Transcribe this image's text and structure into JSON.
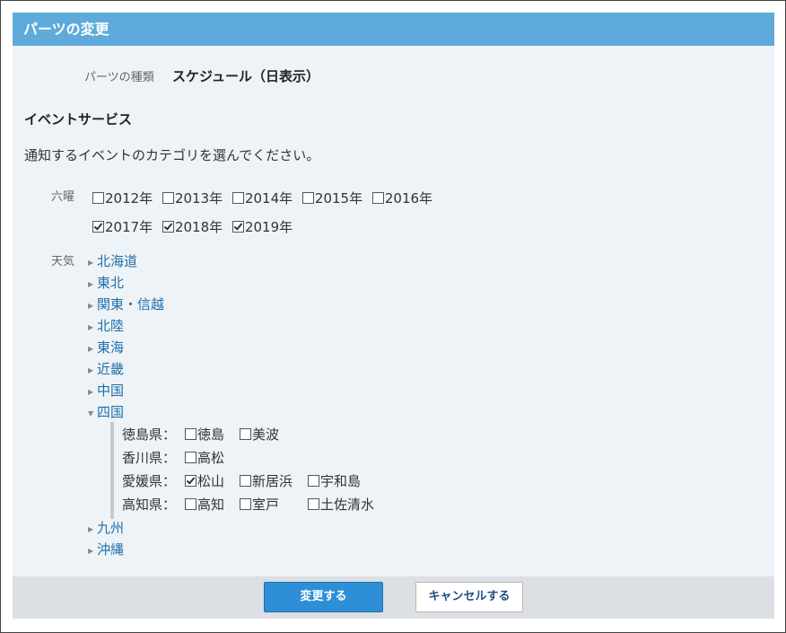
{
  "dialog": {
    "title": "パーツの変更",
    "type_label": "パーツの種類",
    "type_value": "スケジュール（日表示）",
    "section_title": "イベントサービス",
    "description": "通知するイベントのカテゴリを選んでください。"
  },
  "rokuyo": {
    "label": "六曜",
    "row1": [
      {
        "label": "2012年",
        "checked": false
      },
      {
        "label": "2013年",
        "checked": false
      },
      {
        "label": "2014年",
        "checked": false
      },
      {
        "label": "2015年",
        "checked": false
      },
      {
        "label": "2016年",
        "checked": false
      }
    ],
    "row2": [
      {
        "label": "2017年",
        "checked": true
      },
      {
        "label": "2018年",
        "checked": true
      },
      {
        "label": "2019年",
        "checked": true
      }
    ]
  },
  "weather": {
    "label": "天気",
    "regions": [
      {
        "label": "北海道",
        "arrow": "▶"
      },
      {
        "label": "東北",
        "arrow": "▶"
      },
      {
        "label": "関東・信越",
        "arrow": "▶"
      },
      {
        "label": "北陸",
        "arrow": "▶"
      },
      {
        "label": "東海",
        "arrow": "▶"
      },
      {
        "label": "近畿",
        "arrow": "▶"
      },
      {
        "label": "中国",
        "arrow": "▶"
      },
      {
        "label": "四国",
        "arrow": "▼"
      }
    ],
    "regions_after": [
      {
        "label": "九州",
        "arrow": "▶"
      },
      {
        "label": "沖縄",
        "arrow": "▶"
      }
    ],
    "shikoku": [
      {
        "pref": "徳島県：",
        "options": [
          {
            "label": "徳島",
            "checked": false
          },
          {
            "label": "美波",
            "checked": false
          }
        ]
      },
      {
        "pref": "香川県：",
        "options": [
          {
            "label": "高松",
            "checked": false
          }
        ]
      },
      {
        "pref": "愛媛県：",
        "options": [
          {
            "label": "松山",
            "checked": true
          },
          {
            "label": "新居浜",
            "checked": false
          },
          {
            "label": "宇和島",
            "checked": false
          }
        ]
      },
      {
        "pref": "高知県：",
        "options": [
          {
            "label": "高知",
            "checked": false
          },
          {
            "label": "室戸",
            "checked": false
          },
          {
            "label": "土佐清水",
            "checked": false
          }
        ]
      }
    ]
  },
  "footer": {
    "save_label": "変更する",
    "cancel_label": "キャンセルする"
  },
  "colors": {
    "header": "#5eaadb",
    "link": "#1f6fa8",
    "primary_button": "#2e8fd6"
  }
}
